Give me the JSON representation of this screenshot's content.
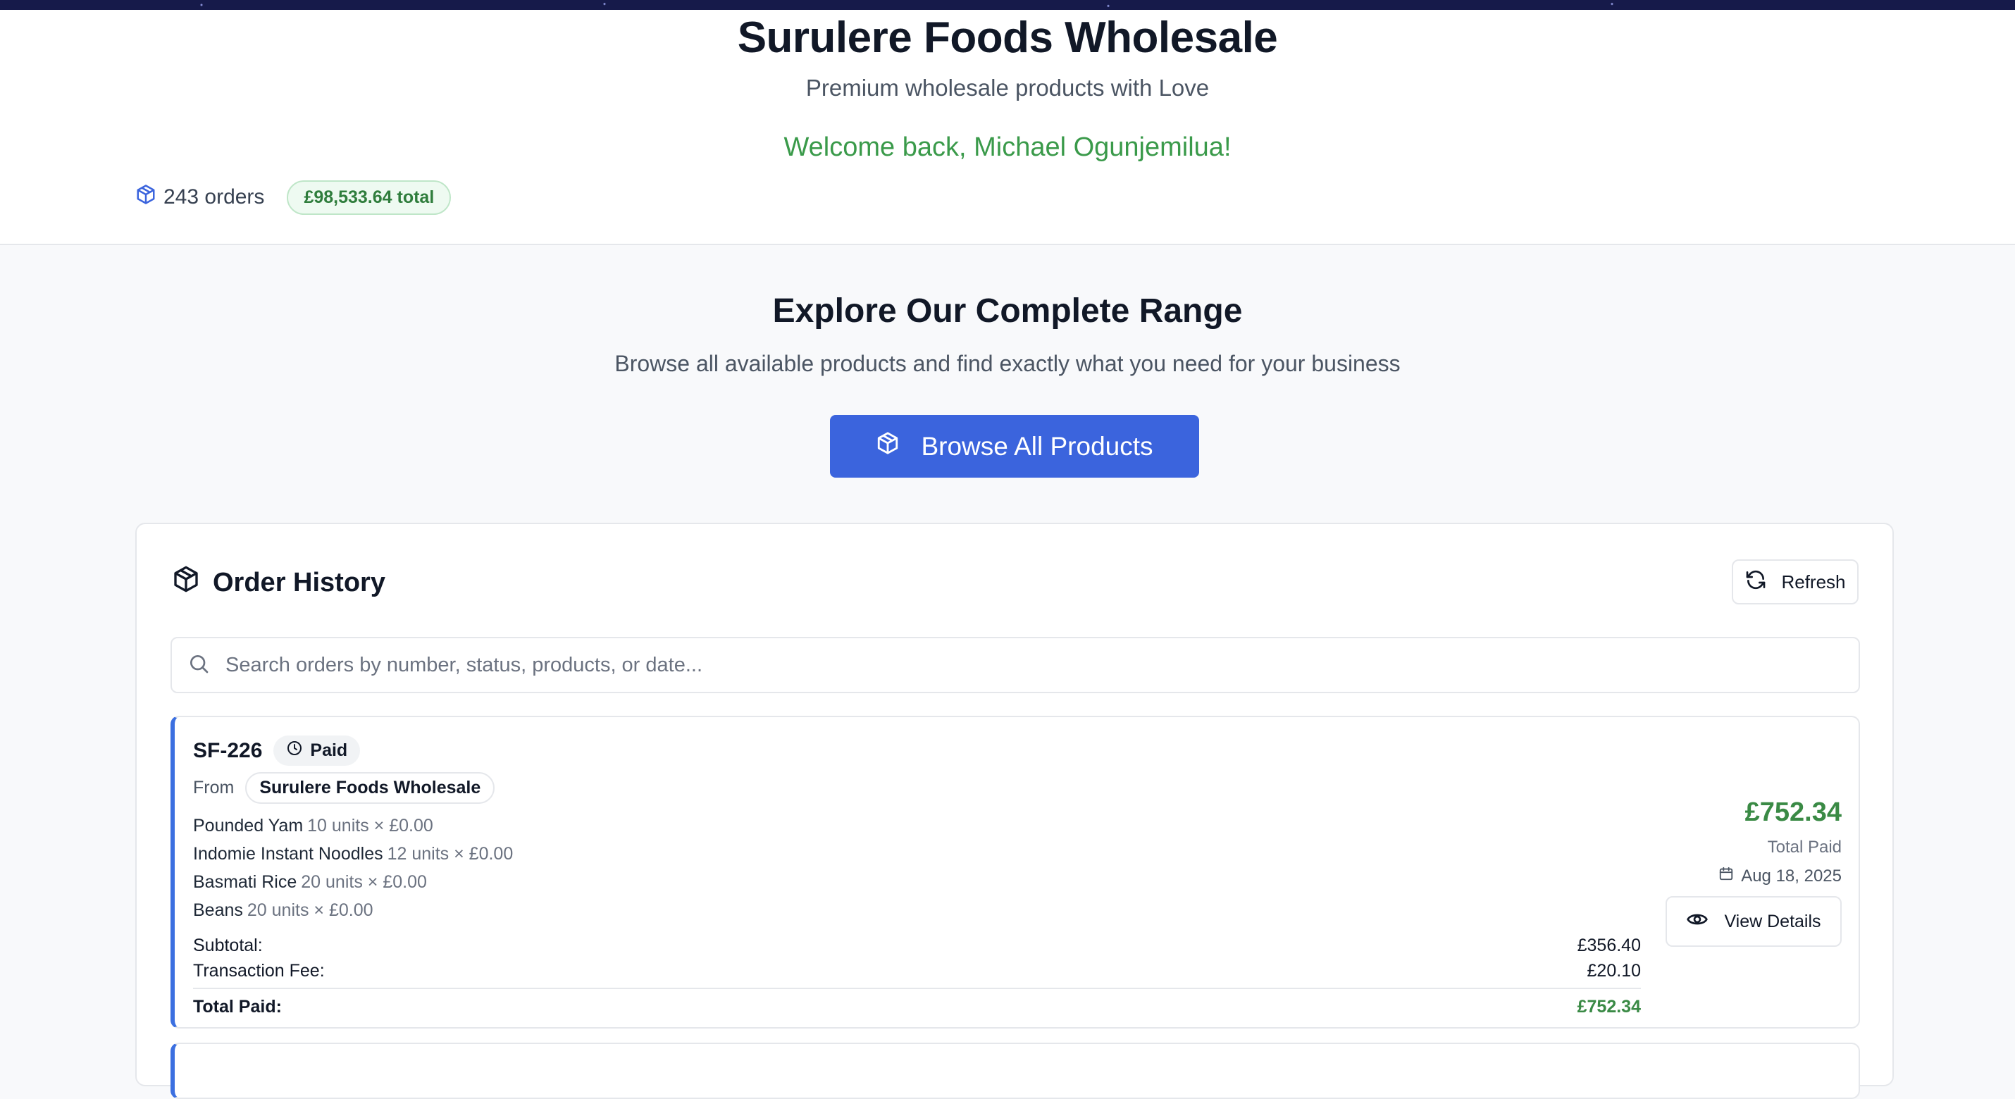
{
  "header": {
    "title": "Surulere Foods Wholesale",
    "subtitle": "Premium wholesale products with Love",
    "welcome": "Welcome back, Michael Ogunjemilua!",
    "orders_count": "243 orders",
    "total_badge": "£98,533.64 total"
  },
  "explore": {
    "title": "Explore Our Complete Range",
    "subtitle": "Browse all available products and find exactly what you need for your business",
    "button_label": "Browse All Products"
  },
  "order_history": {
    "title": "Order History",
    "refresh_label": "Refresh",
    "search_placeholder": "Search orders by number, status, products, or date...",
    "orders": [
      {
        "id": "SF-226",
        "status": "Paid",
        "from_label": "From",
        "vendor": "Surulere Foods Wholesale",
        "items": [
          {
            "name": "Pounded Yam",
            "qty": "10 units × £0.00"
          },
          {
            "name": "Indomie Instant Noodles",
            "qty": "12 units × £0.00"
          },
          {
            "name": "Basmati Rice",
            "qty": "20 units × £0.00"
          },
          {
            "name": "Beans",
            "qty": "20 units × £0.00"
          }
        ],
        "subtotal_label": "Subtotal:",
        "subtotal": "£356.40",
        "fee_label": "Transaction Fee:",
        "fee": "£20.10",
        "total_label": "Total Paid:",
        "total": "£752.34",
        "amount": "£752.34",
        "amount_label": "Total Paid",
        "date": "Aug 18, 2025",
        "view_label": "View Details"
      }
    ]
  },
  "colors": {
    "accent": "#3b64dd",
    "success": "#3a8a45",
    "order_border": "#3b6fe0"
  }
}
